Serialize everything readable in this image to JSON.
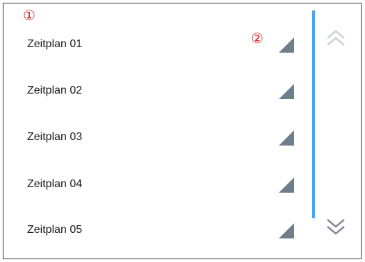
{
  "markers": {
    "list_marker": "①",
    "menu_marker": "②"
  },
  "schedules": [
    {
      "label": "Zeitplan 01"
    },
    {
      "label": "Zeitplan 02"
    },
    {
      "label": "Zeitplan 03"
    },
    {
      "label": "Zeitplan 04"
    },
    {
      "label": "Zeitplan 05"
    }
  ],
  "icons": {
    "row_menu": "corner-triangle-icon",
    "scroll_up": "double-chevron-up-icon",
    "scroll_down": "double-chevron-down-icon"
  },
  "colors": {
    "marker": "#e0201e",
    "scrollbar": "#4da3f2",
    "triangle": "#6e7f8c",
    "chevron_enabled": "#7d8a96",
    "chevron_disabled": "#c9d0d6"
  },
  "scroll": {
    "can_scroll_up": false,
    "can_scroll_down": true
  }
}
